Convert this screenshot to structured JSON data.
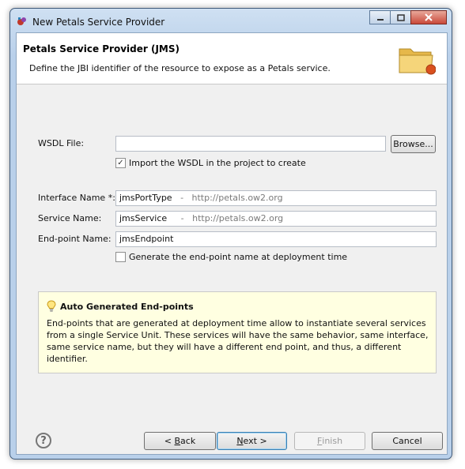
{
  "window": {
    "title": "New Petals Service Provider",
    "minimize_icon": "minimize-icon",
    "maximize_icon": "maximize-icon",
    "close_icon": "close-icon"
  },
  "banner": {
    "title": "Petals Service Provider (JMS)",
    "description": "Define the JBI identifier of the resource to expose as a Petals service.",
    "icon": "folder-icon"
  },
  "form": {
    "wsdl_label": "WSDL File:",
    "wsdl_value": "",
    "browse_label": "Browse...",
    "import_wsdl_label": "Import the WSDL in the project to create",
    "import_wsdl_checked": true,
    "interface_label": "Interface Name *:",
    "interface_value": "jmsPortType",
    "interface_ns": "   -   http://petals.ow2.org",
    "service_label": "Service Name:",
    "service_value": "jmsService",
    "service_ns": "     -   http://petals.ow2.org",
    "endpoint_label": "End-point Name:",
    "endpoint_value": "jmsEndpoint",
    "generate_label": "Generate the end-point name at deployment time",
    "generate_checked": false
  },
  "info": {
    "icon": "lightbulb-icon",
    "title": "Auto Generated End-points",
    "body": "End-points that are generated at deployment time allow to instantiate several services from a single Service Unit. These services will have the same behavior, same interface, same service name, but they will have a different end point, and thus, a different identifier."
  },
  "footer": {
    "help_icon": "help-icon",
    "back_prefix": "< ",
    "back_key": "B",
    "back_rest": "ack",
    "next_key": "N",
    "next_rest": "ext >",
    "finish_key": "F",
    "finish_rest": "inish",
    "cancel_label": "Cancel"
  }
}
